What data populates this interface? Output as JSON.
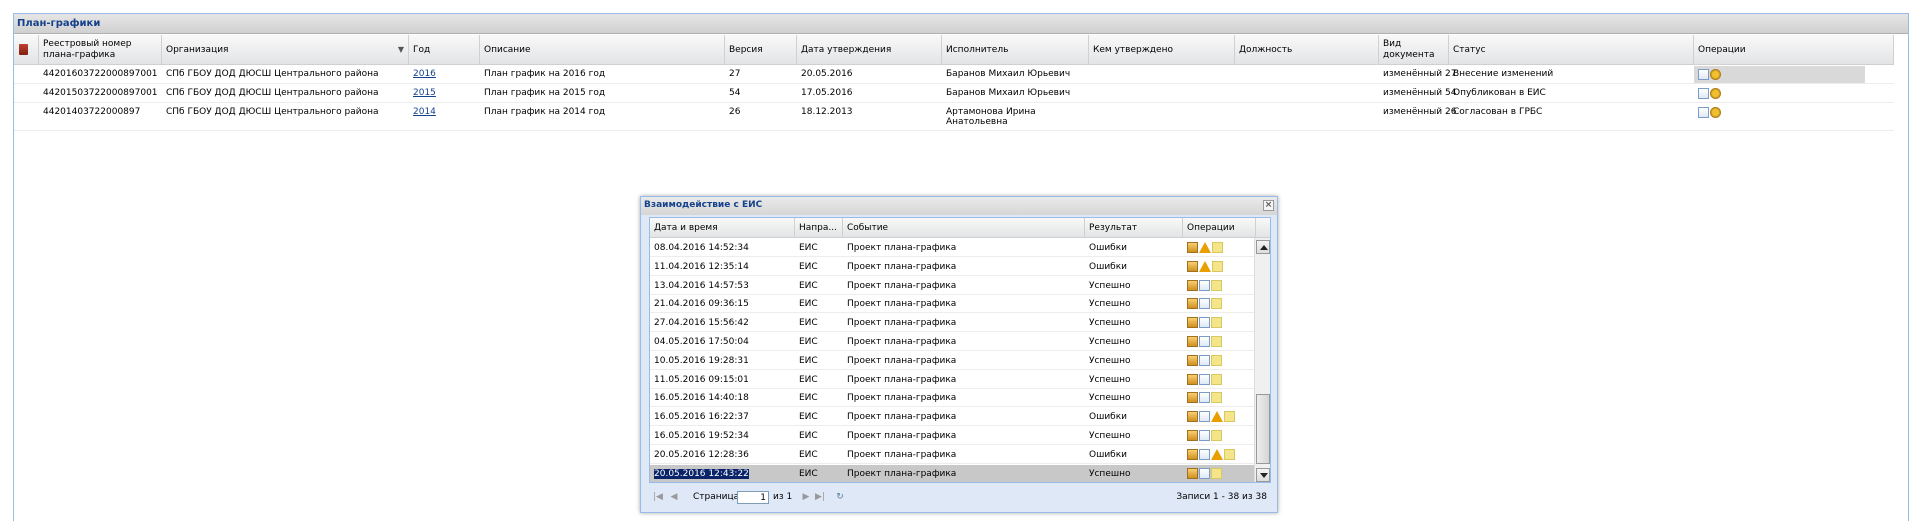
{
  "panel": {
    "title": "План-графики"
  },
  "grid": {
    "headers": {
      "reg_number": "Реестровый номер плана-графика",
      "organization": "Организация",
      "year": "Год",
      "description": "Описание",
      "version": "Версия",
      "approval_date": "Дата утверждения",
      "executor": "Исполнитель",
      "approved_by": "Кем утверждено",
      "position": "Должность",
      "doc_type": "Вид документа",
      "status": "Статус",
      "operations": "Операции"
    },
    "rows": [
      {
        "reg_number": "4420160372200089700‌1",
        "organization": "СПб ГБОУ ДОД ДЮСШ Центрального района",
        "year": "2016",
        "description": "План график на 2016 год",
        "version": "27",
        "approval_date": "20.05.2016",
        "executor": "Баранов Михаил Юрьевич",
        "approved_by": "",
        "position": "",
        "doc_type": "изменённый 27",
        "status": "Внесение изменений"
      },
      {
        "reg_number": "44201503722000897001",
        "organization": "СПб ГБОУ ДОД ДЮСШ Центрального района",
        "year": "2015",
        "description": "План график на 2015 год",
        "version": "54",
        "approval_date": "17.05.2016",
        "executor": "Баранов Михаил Юрьевич",
        "approved_by": "",
        "position": "",
        "doc_type": "изменённый 54",
        "status": "Опубликован в ЕИС"
      },
      {
        "reg_number": "44201403722000897",
        "organization": "СПб ГБОУ ДОД ДЮСШ Центрального района",
        "year": "2014",
        "description": "План график на 2014 год",
        "version": "26",
        "approval_date": "18.12.2013",
        "executor": "Артамонова Ирина Анатольевна",
        "approved_by": "",
        "position": "",
        "doc_type": "изменённый 26",
        "status": "Согласован в ГРБС"
      }
    ]
  },
  "dialog": {
    "title": "Взаимодействие с ЕИС",
    "headers": {
      "datetime": "Дата и время",
      "direction": "Напра...",
      "event": "Событие",
      "result": "Результат",
      "operations": "Операции"
    },
    "rows": [
      {
        "datetime": "08.04.2016 14:52:34",
        "direction": "ЕИС",
        "event": "Проект плана-графика",
        "result": "Ошибки",
        "icons": [
          "box-icon",
          "warning-icon",
          "note-icon"
        ]
      },
      {
        "datetime": "11.04.2016 12:35:14",
        "direction": "ЕИС",
        "event": "Проект плана-графика",
        "result": "Ошибки",
        "icons": [
          "box-icon",
          "warning-icon",
          "note-icon"
        ]
      },
      {
        "datetime": "13.04.2016 14:57:53",
        "direction": "ЕИС",
        "event": "Проект плана-графика",
        "result": "Успешно",
        "icons": [
          "box-icon",
          "doc-icon",
          "note-icon"
        ]
      },
      {
        "datetime": "21.04.2016 09:36:15",
        "direction": "ЕИС",
        "event": "Проект плана-графика",
        "result": "Успешно",
        "icons": [
          "box-icon",
          "doc-icon",
          "note-icon"
        ]
      },
      {
        "datetime": "27.04.2016 15:56:42",
        "direction": "ЕИС",
        "event": "Проект плана-графика",
        "result": "Успешно",
        "icons": [
          "box-icon",
          "doc-icon",
          "note-icon"
        ]
      },
      {
        "datetime": "04.05.2016 17:50:04",
        "direction": "ЕИС",
        "event": "Проект плана-графика",
        "result": "Успешно",
        "icons": [
          "box-icon",
          "doc-icon",
          "note-icon"
        ]
      },
      {
        "datetime": "10.05.2016 19:28:31",
        "direction": "ЕИС",
        "event": "Проект плана-графика",
        "result": "Успешно",
        "icons": [
          "box-icon",
          "doc-icon",
          "note-icon"
        ]
      },
      {
        "datetime": "11.05.2016 09:15:01",
        "direction": "ЕИС",
        "event": "Проект плана-графика",
        "result": "Успешно",
        "icons": [
          "box-icon",
          "doc-icon",
          "note-icon"
        ]
      },
      {
        "datetime": "16.05.2016 14:40:18",
        "direction": "ЕИС",
        "event": "Проект плана-графика",
        "result": "Успешно",
        "icons": [
          "box-icon",
          "doc-icon",
          "note-icon"
        ]
      },
      {
        "datetime": "16.05.2016 16:22:37",
        "direction": "ЕИС",
        "event": "Проект плана-графика",
        "result": "Ошибки",
        "icons": [
          "box-icon",
          "doc-icon",
          "warning-icon",
          "note-icon"
        ]
      },
      {
        "datetime": "16.05.2016 19:52:34",
        "direction": "ЕИС",
        "event": "Проект плана-графика",
        "result": "Успешно",
        "icons": [
          "box-icon",
          "doc-icon",
          "note-icon"
        ]
      },
      {
        "datetime": "20.05.2016 12:28:36",
        "direction": "ЕИС",
        "event": "Проект плана-графика",
        "result": "Ошибки",
        "icons": [
          "box-icon",
          "doc-icon",
          "warning-icon",
          "note-icon"
        ]
      },
      {
        "datetime": "20.05.2016 12:43:22",
        "direction": "ЕИС",
        "event": "Проект плана-графика",
        "result": "Успешно",
        "icons": [
          "box-icon",
          "doc-icon",
          "note-icon"
        ]
      }
    ],
    "pager": {
      "page_label": "Страница",
      "page_value": "1",
      "of_label": "из 1",
      "records": "Записи 1 - 38 из 38"
    }
  }
}
